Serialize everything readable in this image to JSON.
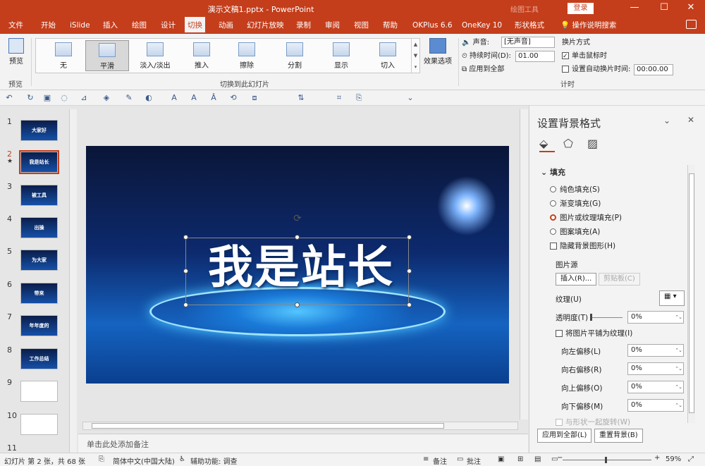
{
  "titlebar": {
    "title": "演示文稿1.pptx  -  PowerPoint",
    "draw_tools": "绘图工具",
    "login": "登录",
    "minimize": "—",
    "restore": "☐",
    "close": "✕"
  },
  "menu": {
    "tabs": [
      "文件",
      "开始",
      "iSlide",
      "插入",
      "绘图",
      "设计",
      "切换",
      "动画",
      "幻灯片放映",
      "录制",
      "审阅",
      "视图",
      "帮助",
      "OKPlus 6.6",
      "OneKey 10",
      "形状格式"
    ],
    "active": "切换",
    "help_search": "操作说明搜索"
  },
  "ribbon": {
    "preview_label": "预览",
    "preview_group": "预览",
    "transitions": [
      "无",
      "平滑",
      "淡入/淡出",
      "推入",
      "擦除",
      "分割",
      "显示",
      "切入"
    ],
    "selected_transition": "平滑",
    "gallery_group": "切换到此幻灯片",
    "effect_options": "效果选项",
    "timing": {
      "sound_label": "声音:",
      "sound_value": "[无声音]",
      "duration_label": "持续时间(D):",
      "duration_value": "01.00",
      "apply_all": "应用到全部",
      "advance_title": "换片方式",
      "on_click": "单击鼠标时",
      "auto_after": "设置自动换片时间:",
      "auto_value": "00:00.00",
      "group": "计时"
    }
  },
  "slides": [
    {
      "num": "1",
      "text": "大家好"
    },
    {
      "num": "2",
      "text": "我是站长"
    },
    {
      "num": "3",
      "text": "被工具"
    },
    {
      "num": "4",
      "text": "出操"
    },
    {
      "num": "5",
      "text": "为大家"
    },
    {
      "num": "6",
      "text": "带来"
    },
    {
      "num": "7",
      "text": "年年度的"
    },
    {
      "num": "8",
      "text": "工作总结"
    },
    {
      "num": "9",
      "text": ""
    },
    {
      "num": "10",
      "text": ""
    },
    {
      "num": "11",
      "text": ""
    }
  ],
  "current_slide_star": "★",
  "canvas": {
    "headline": "我是站长",
    "notes_placeholder": "单击此处添加备注"
  },
  "pane": {
    "title": "设置背景格式",
    "section": "填充",
    "fill_options": [
      "纯色填充(S)",
      "渐变填充(G)",
      "图片或纹理填充(P)",
      "图案填充(A)"
    ],
    "selected_fill": "图片或纹理填充(P)",
    "hide_bg": "隐藏背景图形(H)",
    "picture_source": "图片源",
    "insert_btn": "插入(R)...",
    "clipboard_btn": "剪贴板(C)",
    "texture_label": "纹理(U)",
    "transparency_label": "透明度(T)",
    "transparency_value": "0%",
    "tile_label": "将图片平铺为纹理(I)",
    "offsets": [
      {
        "label": "向左偏移(L)",
        "value": "0%"
      },
      {
        "label": "向右偏移(R)",
        "value": "0%"
      },
      {
        "label": "向上偏移(O)",
        "value": "0%"
      },
      {
        "label": "向下偏移(M)",
        "value": "0%"
      }
    ],
    "rotate_with_shape": "与形状一起旋转(W)",
    "apply_all_btn": "应用到全部(L)",
    "reset_btn": "重置背景(B)"
  },
  "status": {
    "slide_info": "幻灯片 第 2 张，共 68 张",
    "language": "简体中文(中国大陆)",
    "accessibility": "辅助功能: 调查",
    "notes": "备注",
    "comments": "批注",
    "zoom": "59%"
  },
  "colors": {
    "brand": "#c43e1c",
    "ribbon_bg": "#f3f3f3",
    "slide_blue": "#1563c0"
  }
}
